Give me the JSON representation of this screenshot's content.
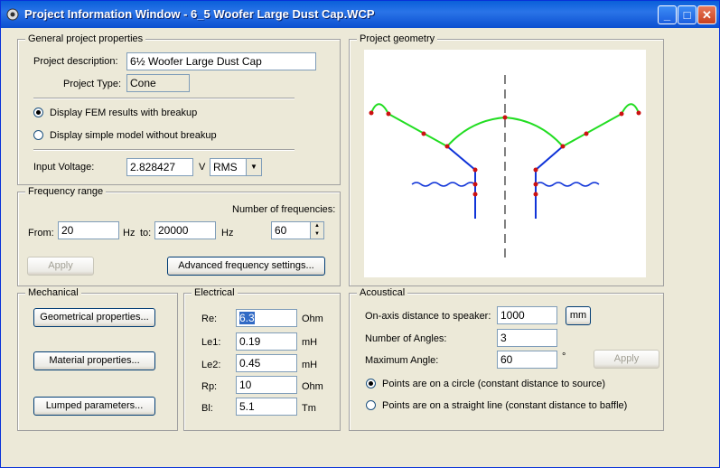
{
  "window": {
    "title": "Project Information Window - 6_5 Woofer Large Dust Cap.WCP",
    "minimize": "_",
    "maximize": "□",
    "close": "✕"
  },
  "general": {
    "group_label": "General project properties",
    "description_label": "Project description:",
    "description_value": "6½ Woofer Large Dust Cap",
    "type_label": "Project Type:",
    "type_value": "Cone",
    "radio_fem": "Display FEM results with breakup",
    "radio_simple": "Display simple model without breakup",
    "voltage_label": "Input Voltage:",
    "voltage_value": "2.828427",
    "voltage_unit": "V",
    "voltage_mode": "RMS"
  },
  "frequency": {
    "group_label": "Frequency range",
    "num_label": "Number of frequencies:",
    "from_label": "From:",
    "from_value": "20",
    "hz1": "Hz",
    "to_label": "to:",
    "to_value": "20000",
    "hz2": "Hz",
    "num_value": "60",
    "apply": "Apply",
    "advanced": "Advanced frequency settings..."
  },
  "mechanical": {
    "group_label": "Mechanical",
    "geom_btn": "Geometrical properties...",
    "mat_btn": "Material properties...",
    "lump_btn": "Lumped parameters..."
  },
  "electrical": {
    "group_label": "Electrical",
    "rows": [
      {
        "label": "Re:",
        "value": "6.3",
        "unit": "Ohm"
      },
      {
        "label": "Le1:",
        "value": "0.19",
        "unit": "mH"
      },
      {
        "label": "Le2:",
        "value": "0.45",
        "unit": "mH"
      },
      {
        "label": "Rp:",
        "value": "10",
        "unit": "Ohm"
      },
      {
        "label": "Bl:",
        "value": "5.1",
        "unit": "Tm"
      }
    ]
  },
  "geometry": {
    "group_label": "Project geometry",
    "colors": {
      "cone": "#22dd22",
      "structure": "#1034d8",
      "nodes": "#cc1111",
      "axis": "#000000"
    }
  },
  "acoustical": {
    "group_label": "Acoustical",
    "dist_label": "On-axis distance to speaker:",
    "dist_value": "1000",
    "unit_btn": "mm",
    "angles_label": "Number of Angles:",
    "angles_value": "3",
    "max_label": "Maximum Angle:",
    "max_value": "60",
    "deg": "°",
    "apply": "Apply",
    "radio_circle": "Points are on a circle (constant distance to source)",
    "radio_line": "Points are on a straight line (constant distance to baffle)"
  }
}
